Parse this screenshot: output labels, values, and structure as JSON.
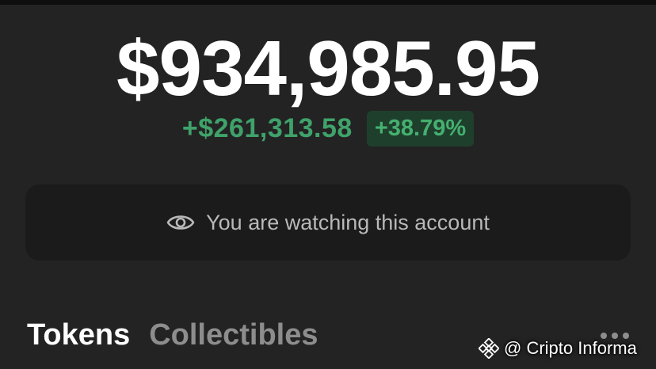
{
  "wallet": {
    "balance": "$934,985.95",
    "change_amount": "+$261,313.58",
    "change_percent": "+38.79%",
    "change_color": "#45b06f"
  },
  "watch_banner": {
    "icon": "eye-icon",
    "text": "You are watching this account"
  },
  "tabs": [
    {
      "label": "Tokens",
      "active": true
    },
    {
      "label": "Collectibles",
      "active": false
    }
  ],
  "more_menu": {
    "icon": "more-horizontal-icon"
  },
  "watermark": {
    "logo": "binance-logo",
    "text": "@ Cripto Informa"
  }
}
